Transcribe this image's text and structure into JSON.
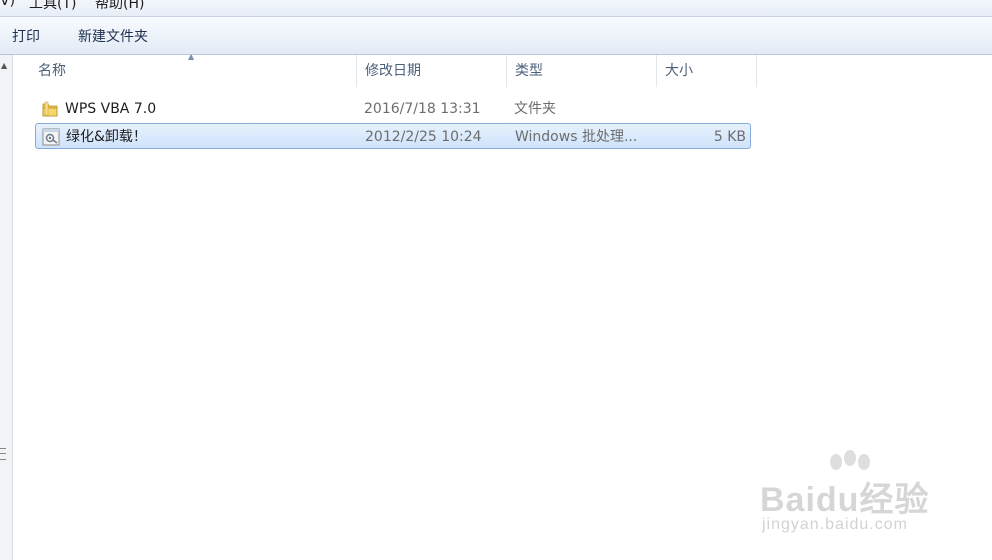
{
  "menubar": {
    "items": [
      {
        "label": "V)"
      },
      {
        "label": "工具(T)"
      },
      {
        "label": "帮助(H)"
      }
    ]
  },
  "toolbar": {
    "print_label": "打印",
    "new_folder_label": "新建文件夹"
  },
  "columns": {
    "name": "名称",
    "modified": "修改日期",
    "type": "类型",
    "size": "大小"
  },
  "files": [
    {
      "name": "WPS VBA 7.0",
      "modified": "2016/7/18 13:31",
      "type": "文件夹",
      "size": "",
      "icon": "folder-icon",
      "selected": false
    },
    {
      "name": "绿化&卸载！",
      "modified": "2012/2/25 10:24",
      "type": "Windows 批处理...",
      "size": "5 KB",
      "icon": "batch-file-icon",
      "selected": true
    }
  ],
  "watermark": {
    "logo": "Baidu经验",
    "url": "jingyan.baidu.com"
  },
  "colors": {
    "selection": "#cfe3fb",
    "selection_border": "#84acdd",
    "folder": "#e8c24a"
  }
}
